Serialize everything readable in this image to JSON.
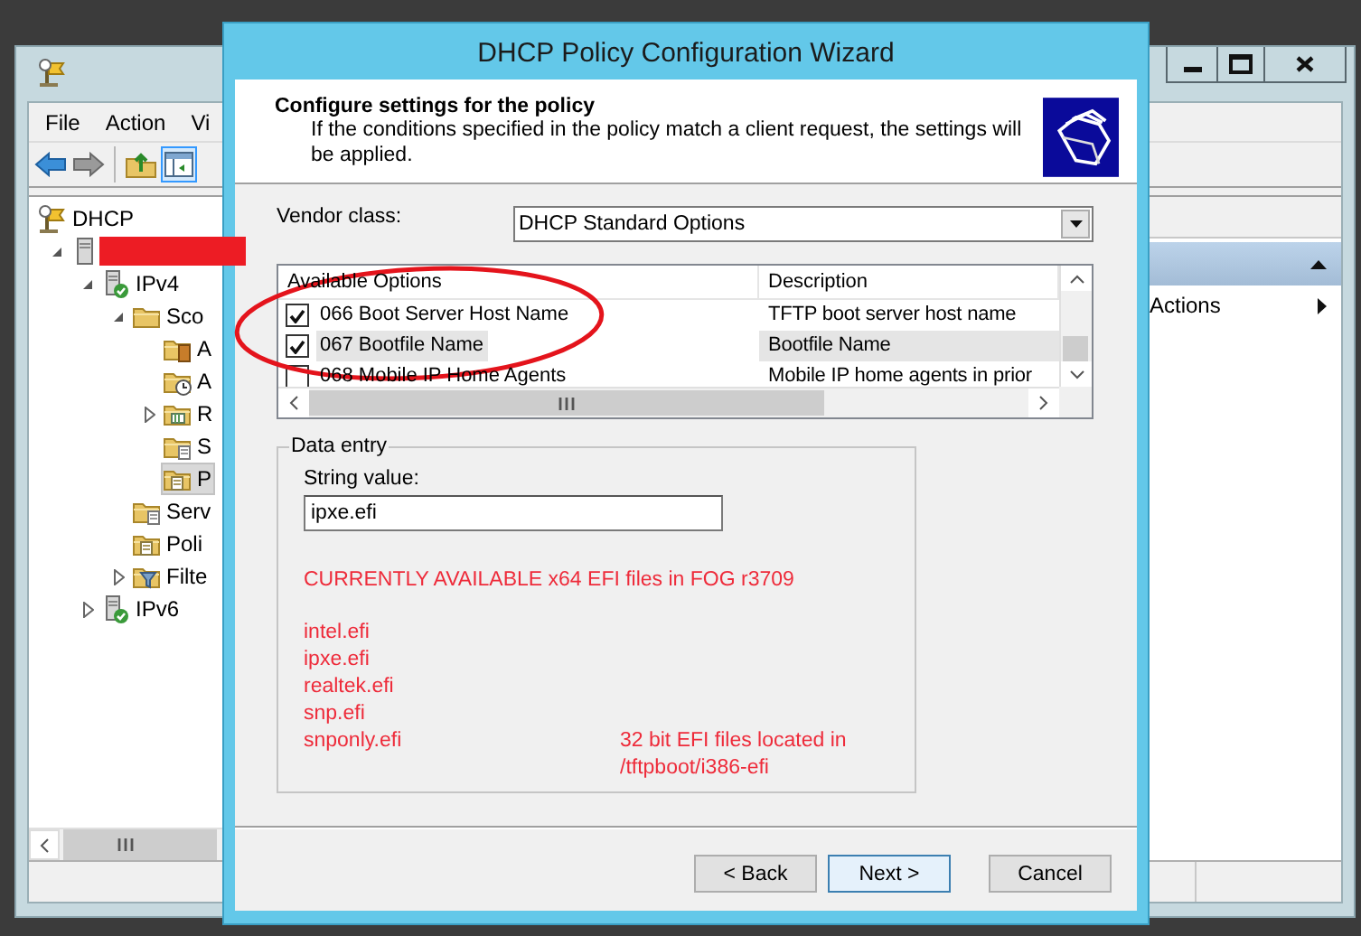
{
  "main_window": {
    "menu": [
      {
        "label": "File"
      },
      {
        "label": "Action"
      },
      {
        "label": "Vi"
      }
    ],
    "toolbar": [
      {
        "kind": "back",
        "selected": false
      },
      {
        "kind": "forward",
        "selected": false
      },
      {
        "kind": "up",
        "selected": false
      },
      {
        "kind": "pane",
        "selected": true
      }
    ],
    "tree": [
      {
        "label": "DHCP",
        "kind": "dhcp",
        "selected": false,
        "children": [
          {
            "redacted": true,
            "kind": "server",
            "expanded": true,
            "selected": false,
            "children": [
              {
                "label": "IPv4",
                "kind": "protocol",
                "expanded": true,
                "selected": false,
                "children": [
                  {
                    "label": "Sco",
                    "kind": "folder",
                    "expanded": true,
                    "selected": false,
                    "children": [
                      {
                        "label": "A",
                        "kind": "folder-book",
                        "selected": false
                      },
                      {
                        "label": "A",
                        "kind": "folder-clock",
                        "selected": false
                      },
                      {
                        "label": "R",
                        "kind": "folder-grid",
                        "expanded": false,
                        "selected": false
                      },
                      {
                        "label": "S",
                        "kind": "folder-doc",
                        "selected": false
                      },
                      {
                        "label": "P",
                        "kind": "folder-policy",
                        "selected": true
                      }
                    ]
                  },
                  {
                    "label": "Serv",
                    "kind": "folder-doc",
                    "selected": false
                  },
                  {
                    "label": "Poli",
                    "kind": "folder-policy",
                    "selected": false
                  },
                  {
                    "label": "Filte",
                    "kind": "folder-filter",
                    "expanded": false,
                    "selected": false
                  }
                ]
              },
              {
                "label": "IPv6",
                "kind": "protocol",
                "expanded": false,
                "selected": false
              }
            ]
          }
        ]
      }
    ],
    "actions_pane": {
      "items": [
        {
          "label": "Actions"
        }
      ]
    }
  },
  "dialog": {
    "title": "DHCP Policy Configuration Wizard",
    "heading": "Configure settings for the policy",
    "description": "If the conditions specified in the policy match a client request, the settings will be applied.",
    "vendor_class": {
      "label": "Vendor class:",
      "value": "DHCP Standard Options"
    },
    "options": {
      "columns": [
        "Available Options",
        "Description"
      ],
      "rows": [
        {
          "checked": true,
          "selected": false,
          "name": "066 Boot Server Host Name",
          "description": "TFTP boot server host name"
        },
        {
          "checked": true,
          "selected": true,
          "name": "067 Bootfile Name",
          "description": "Bootfile Name"
        },
        {
          "checked": false,
          "selected": false,
          "name": "068 Mobile IP Home Agents",
          "description": "Mobile IP home agents in prior"
        }
      ]
    },
    "data_entry": {
      "legend": "Data entry",
      "label": "String value:",
      "value": "ipxe.efi",
      "notes": {
        "heading": "CURRENTLY AVAILABLE x64 EFI files in FOG r3709",
        "files": [
          "intel.efi",
          "ipxe.efi",
          "realtek.efi",
          "snp.efi",
          "snponly.efi"
        ],
        "aside": [
          "32 bit EFI files located in",
          "/tftpboot/i386-efi"
        ]
      }
    },
    "buttons": [
      {
        "label": "< Back",
        "default": false
      },
      {
        "label": "Next >",
        "default": true
      },
      {
        "label": "Cancel",
        "default": false
      }
    ]
  }
}
